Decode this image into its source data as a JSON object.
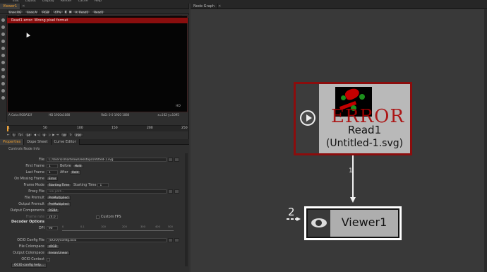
{
  "menubar": {
    "items": [
      "Edit",
      "Layout",
      "Display",
      "Render",
      "Cache",
      "Help"
    ]
  },
  "viewer": {
    "tab": "Viewer1",
    "toolbar": {
      "channels": "lines.RG",
      "mode": "lines.A",
      "colorspace": "RGB",
      "zoom": "47%",
      "a_input": "A: Read1",
      "b_input": "Read1",
      "gamma_value": "0.0",
      "gain_value": "1.0",
      "y_label": "Y",
      "lut": "sRGB"
    },
    "error_message": "Read1 error: Wrong pixel format",
    "hd_badge": "HD",
    "info": {
      "channels": "A Color.RGBA32f",
      "format": "HD 1920x1080",
      "bbox": "RoD: 0 0 1920 1080",
      "coords": "x=162 y=1095"
    }
  },
  "timeline": {
    "ticks": [
      "1",
      "50",
      "100",
      "150",
      "200",
      "250"
    ],
    "frame": "1",
    "fps_label": "fps",
    "fps_value": "24",
    "current_frame": "8",
    "step": "10",
    "end_frame": "250",
    "start_frame": "1"
  },
  "properties": {
    "tabs": [
      "Properties",
      "Dope Sheet",
      "Curve Editor"
    ],
    "section_title": "Controls  Node Info",
    "file": {
      "label": "File",
      "value": "C:/Users/smarbrow/Desktop/Untitled-1.svg"
    },
    "first_frame": {
      "label": "First Frame",
      "value": "1",
      "before_label": "Before",
      "before": "Hold"
    },
    "last_frame": {
      "label": "Last Frame",
      "value": "1",
      "after_label": "After",
      "after": "Hold"
    },
    "on_missing": {
      "label": "On Missing Frame",
      "value": "Error"
    },
    "frame_mode": {
      "label": "Frame Mode",
      "value": "Starting Time",
      "starting_label": "Starting Time",
      "starting_value": "1"
    },
    "proxy_file": {
      "label": "Proxy File",
      "placeholder": "File path..."
    },
    "file_premult": {
      "label": "File Premult",
      "value": "PreMultiplied"
    },
    "output_premult": {
      "label": "Output Premult",
      "value": "PreMultiplied"
    },
    "output_components": {
      "label": "Output Components",
      "value": "RGBA"
    },
    "frame_rate": {
      "label": "Frame rate",
      "value": "24.0",
      "custom_label": "Custom FPS"
    },
    "decoder_title": "Decoder Options",
    "dpi": {
      "label": "DPI",
      "value": "90",
      "scale": [
        "0",
        "0.1",
        "100",
        "200",
        "300",
        "400",
        "500"
      ]
    },
    "ocio_config": {
      "label": "OCIO Config File",
      "value": "[OCIO]/config.ocio"
    },
    "file_colorspace": {
      "label": "File Colorspace",
      "value": "sRGB"
    },
    "output_colorspace": {
      "label": "Output Colorspace",
      "value": "linear/Linear"
    },
    "ocio_context": {
      "label": "OCIO Context"
    },
    "ocio_help": "OCIO config help..."
  },
  "node_graph": {
    "tab": "Node Graph",
    "read_node": {
      "name": "Read1",
      "subtitle": "(Untitled-1.svg)",
      "error_text": "ERROR",
      "border_color": "#8b0d0d"
    },
    "viewer_node": {
      "name": "Viewer1",
      "input_number": "2",
      "border_color": "#ffffff"
    },
    "edge_label": "1"
  },
  "colors": {
    "accent": "#f0a030",
    "error": "#8a0e0e"
  }
}
